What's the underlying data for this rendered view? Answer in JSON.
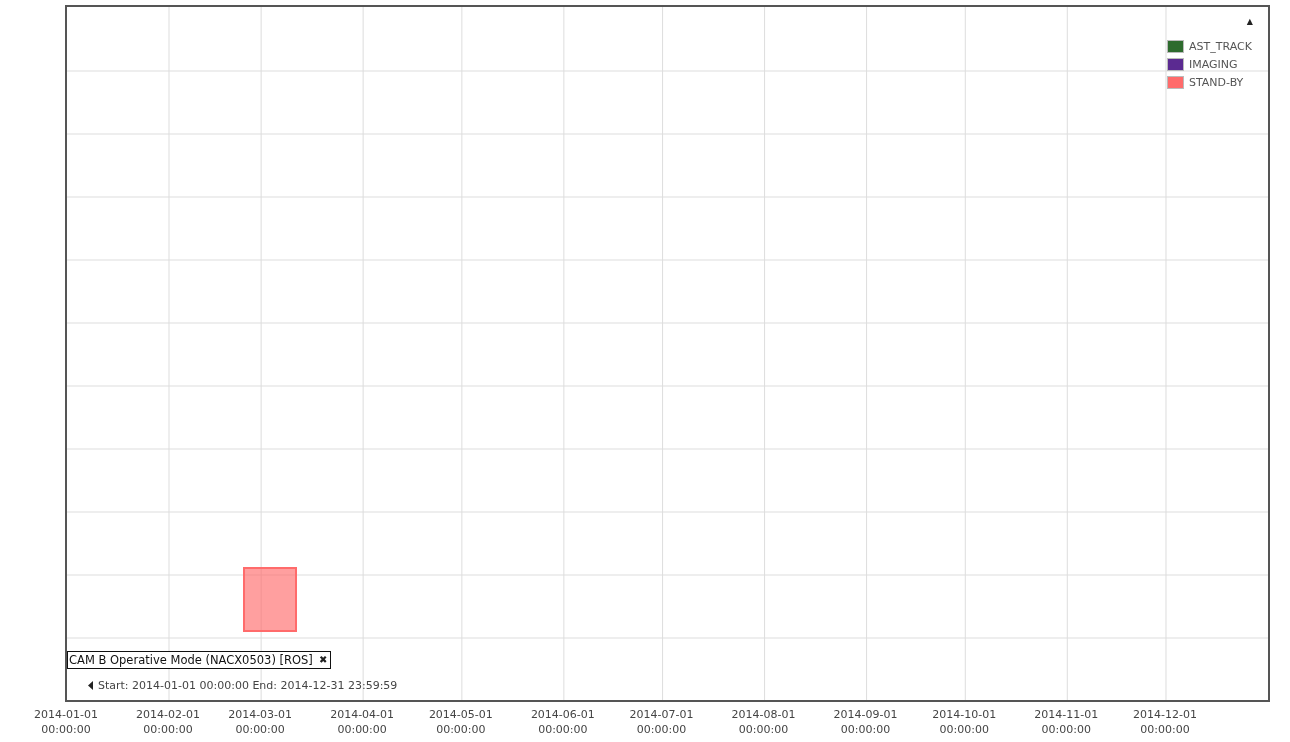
{
  "legend": {
    "collapse_glyph": "▲",
    "items": [
      {
        "label": "AST_TRACK",
        "color": "#2e6b2e"
      },
      {
        "label": "IMAGING",
        "color": "#5b2a91"
      },
      {
        "label": "STAND-BY",
        "color": "#ff6b6b"
      }
    ]
  },
  "series_tag": {
    "label": "CAM B Operative Mode (NACX0503) [ROS]",
    "close_glyph": "✖"
  },
  "range": {
    "text": "Start: 2014-01-01 00:00:00 End: 2014-12-31 23:59:59"
  },
  "x_ticks": [
    {
      "date": "2014-01-01",
      "time": "00:00:00"
    },
    {
      "date": "2014-02-01",
      "time": "00:00:00"
    },
    {
      "date": "2014-03-01",
      "time": "00:00:00"
    },
    {
      "date": "2014-04-01",
      "time": "00:00:00"
    },
    {
      "date": "2014-05-01",
      "time": "00:00:00"
    },
    {
      "date": "2014-06-01",
      "time": "00:00:00"
    },
    {
      "date": "2014-07-01",
      "time": "00:00:00"
    },
    {
      "date": "2014-08-01",
      "time": "00:00:00"
    },
    {
      "date": "2014-09-01",
      "time": "00:00:00"
    },
    {
      "date": "2014-10-01",
      "time": "00:00:00"
    },
    {
      "date": "2014-11-01",
      "time": "00:00:00"
    },
    {
      "date": "2014-12-01",
      "time": "00:00:00"
    }
  ]
}
